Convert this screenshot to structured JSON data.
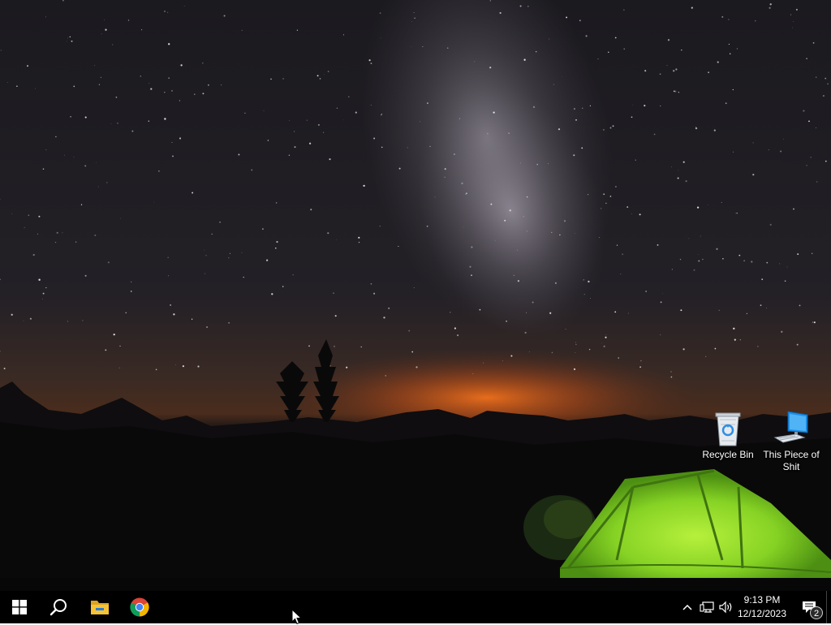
{
  "desktop": {
    "icons": [
      {
        "label": "Recycle Bin",
        "icon": "recycle-bin-icon"
      },
      {
        "label": "This Piece of Shit",
        "icon": "computer-icon"
      }
    ]
  },
  "taskbar": {
    "start": {
      "icon": "windows-logo-icon"
    },
    "search": {
      "icon": "search-icon"
    },
    "pinned": [
      {
        "app": "File Explorer",
        "icon": "folder-icon"
      },
      {
        "app": "Google Chrome",
        "icon": "chrome-icon"
      }
    ],
    "tray": {
      "icons": [
        "chevron-up-icon",
        "network-icon",
        "volume-icon"
      ],
      "time": "9:13 PM",
      "date": "12/12/2023",
      "notifications": {
        "icon": "notification-icon",
        "count": "2"
      }
    }
  },
  "colors": {
    "taskbar_bg": "#000000",
    "tent_green": "#8ee02a",
    "horizon_glow": "#e0621a",
    "sky": "#1e1c24",
    "windows_blue": "#ffffff",
    "chrome_red": "#db4437",
    "chrome_yellow": "#f4b400",
    "chrome_green": "#0f9d58",
    "chrome_blue": "#4285f4",
    "folder_yellow": "#f5c338"
  }
}
